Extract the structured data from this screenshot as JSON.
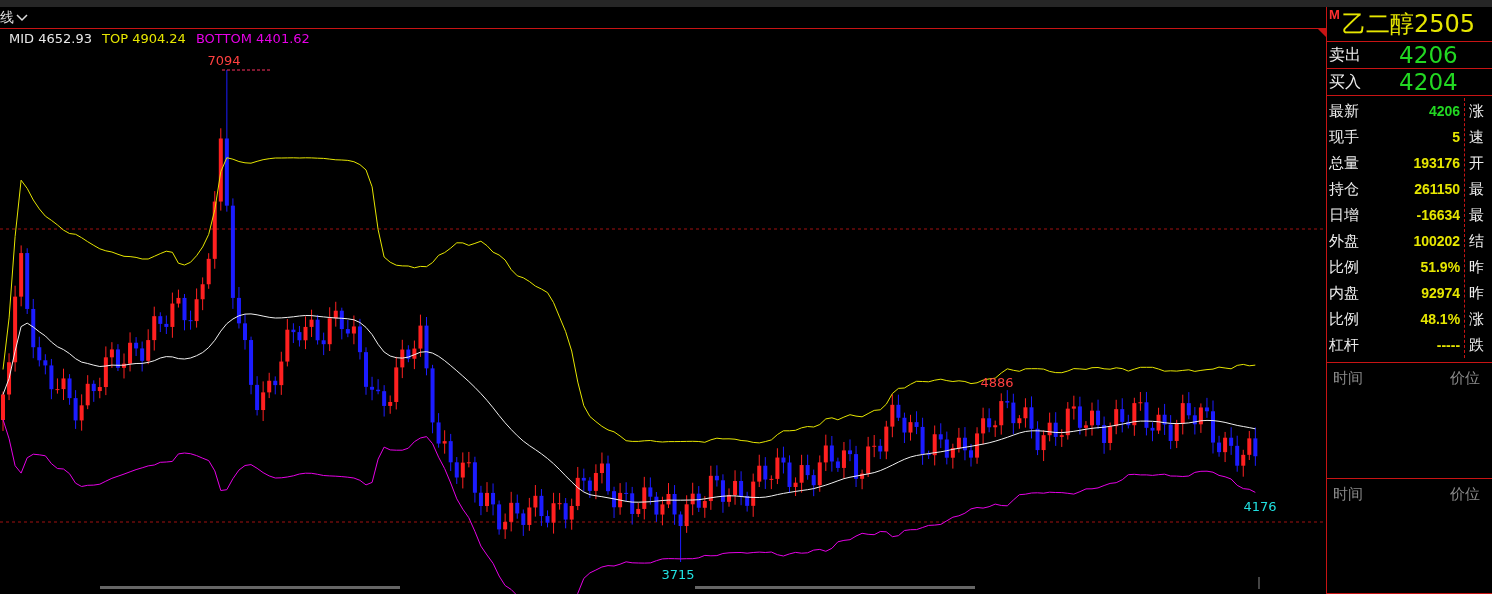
{
  "header": {
    "tab_label": "线"
  },
  "legend": [
    {
      "kind": "mid",
      "label": "MID",
      "value": "4652.93"
    },
    {
      "kind": "top",
      "label": "TOP",
      "value": "4904.24"
    },
    {
      "kind": "bottom",
      "label": "BOTTOM",
      "value": "4401.62"
    }
  ],
  "chart": {
    "price_labels": [
      {
        "kind": "high",
        "text": "7094"
      },
      {
        "kind": "high",
        "text": "4886"
      },
      {
        "kind": "low",
        "text": "3715"
      },
      {
        "kind": "low",
        "text": "4176"
      }
    ]
  },
  "quote": {
    "badge": "M",
    "symbol": "乙二醇2505",
    "ask": {
      "label": "卖出",
      "value": "4206"
    },
    "bid": {
      "label": "买入",
      "value": "4204"
    }
  },
  "stats": [
    {
      "label": "最新",
      "value": "4206",
      "kind": "price",
      "side_label": "涨"
    },
    {
      "label": "现手",
      "value": "5",
      "kind": "plain",
      "side_label": "速"
    },
    {
      "label": "总量",
      "value": "193176",
      "kind": "plain",
      "side_label": "开"
    },
    {
      "label": "持仓",
      "value": "261150",
      "kind": "plain",
      "side_label": "最"
    },
    {
      "label": "日增",
      "value": "-16634",
      "kind": "plain",
      "side_label": "最"
    },
    {
      "label": "外盘",
      "value": "100202",
      "kind": "plain",
      "side_label": "结"
    },
    {
      "label": "比例",
      "value": "51.9%",
      "kind": "plain",
      "side_label": "昨"
    },
    {
      "label": "内盘",
      "value": "92974",
      "kind": "plain",
      "side_label": "昨"
    },
    {
      "label": "比例",
      "value": "48.1%",
      "kind": "plain",
      "side_label": "涨"
    },
    {
      "label": "杠杆",
      "value": "-----",
      "kind": "plain",
      "side_label": "跌"
    }
  ],
  "trade_headers": [
    {
      "time": "时间",
      "price": "价位"
    },
    {
      "time": "时间",
      "price": "价位"
    }
  ]
}
